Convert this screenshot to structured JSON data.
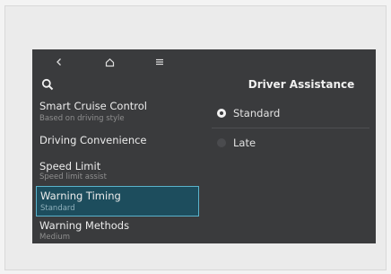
{
  "nav": {
    "back_icon": "chevron-left-icon",
    "home_icon": "home-icon",
    "menu_icon": "menu-icon",
    "search_icon": "search-icon"
  },
  "panel": {
    "title": "Driver Assistance"
  },
  "menu": [
    {
      "label": "Smart Cruise Control",
      "sub": "Based on driving style",
      "selected": false
    },
    {
      "label": "Driving Convenience",
      "sub": "",
      "selected": false
    },
    {
      "label": "Speed Limit",
      "sub": "Speed limit assist",
      "selected": false
    },
    {
      "label": "Warning Timing",
      "sub": "Standard",
      "selected": true
    },
    {
      "label": "Warning Methods",
      "sub": "Medium",
      "selected": false
    }
  ],
  "options": [
    {
      "label": "Standard",
      "selected": true
    },
    {
      "label": "Late",
      "selected": false
    }
  ],
  "colors": {
    "screen_bg": "#3a3b3d",
    "highlight_bg": "#1d4d5d",
    "highlight_border": "#5ab3cb"
  }
}
